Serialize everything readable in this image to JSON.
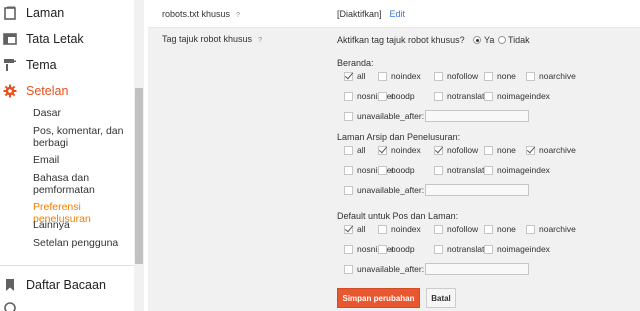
{
  "sidebar": {
    "nav": [
      {
        "label": "Laman",
        "icon": "pages-icon",
        "active": false
      },
      {
        "label": "Tata Letak",
        "icon": "layout-icon",
        "active": false
      },
      {
        "label": "Tema",
        "icon": "paint-roller-icon",
        "active": false
      },
      {
        "label": "Setelan",
        "icon": "gear-icon",
        "active": true
      }
    ],
    "sub": [
      "Dasar",
      "Pos, komentar, dan berbagi",
      "Email",
      "Bahasa dan pemformatan",
      "Preferensi penelusuran",
      "Lainnya",
      "Setelan pengguna"
    ],
    "reading_list": "Daftar Bacaan",
    "accent": "#e8511f"
  },
  "robots_txt": {
    "label": "robots.txt khusus",
    "help": "?",
    "status": "[Diaktifkan]",
    "edit": "Edit"
  },
  "header_tags": {
    "label": "Tag tajuk robot khusus",
    "help": "?",
    "enable_question": "Aktifkan tag tajuk robot khusus?",
    "yes": "Ya",
    "no": "Tidak",
    "selected": "Ya",
    "sections": [
      {
        "title": "Beranda:",
        "options": [
          {
            "label": "all",
            "checked": true
          },
          {
            "label": "noindex",
            "checked": false
          },
          {
            "label": "nofollow",
            "checked": false
          },
          {
            "label": "none",
            "checked": false
          },
          {
            "label": "noarchive",
            "checked": false
          },
          {
            "label": "nosnippet",
            "checked": false
          },
          {
            "label": "noodp",
            "checked": false
          },
          {
            "label": "notranslate",
            "checked": false
          },
          {
            "label": "noimageindex",
            "checked": false
          },
          {
            "label": "unavailable_after:",
            "checked": false
          }
        ]
      },
      {
        "title": "Laman Arsip dan Penelusuran:",
        "options": [
          {
            "label": "all",
            "checked": false
          },
          {
            "label": "noindex",
            "checked": true
          },
          {
            "label": "nofollow",
            "checked": true
          },
          {
            "label": "none",
            "checked": false
          },
          {
            "label": "noarchive",
            "checked": true
          },
          {
            "label": "nosnippet",
            "checked": false
          },
          {
            "label": "noodp",
            "checked": false
          },
          {
            "label": "notranslate",
            "checked": false
          },
          {
            "label": "noimageindex",
            "checked": false
          },
          {
            "label": "unavailable_after:",
            "checked": false
          }
        ]
      },
      {
        "title": "Default untuk Pos dan Laman:",
        "options": [
          {
            "label": "all",
            "checked": true
          },
          {
            "label": "noindex",
            "checked": false
          },
          {
            "label": "nofollow",
            "checked": false
          },
          {
            "label": "none",
            "checked": false
          },
          {
            "label": "noarchive",
            "checked": false
          },
          {
            "label": "nosnippet",
            "checked": false
          },
          {
            "label": "noodp",
            "checked": false
          },
          {
            "label": "notranslate",
            "checked": false
          },
          {
            "label": "noimageindex",
            "checked": false
          },
          {
            "label": "unavailable_after:",
            "checked": false
          }
        ]
      }
    ]
  },
  "buttons": {
    "save": "Simpan perubahan",
    "cancel": "Batal",
    "save_color": "#e8572f"
  }
}
